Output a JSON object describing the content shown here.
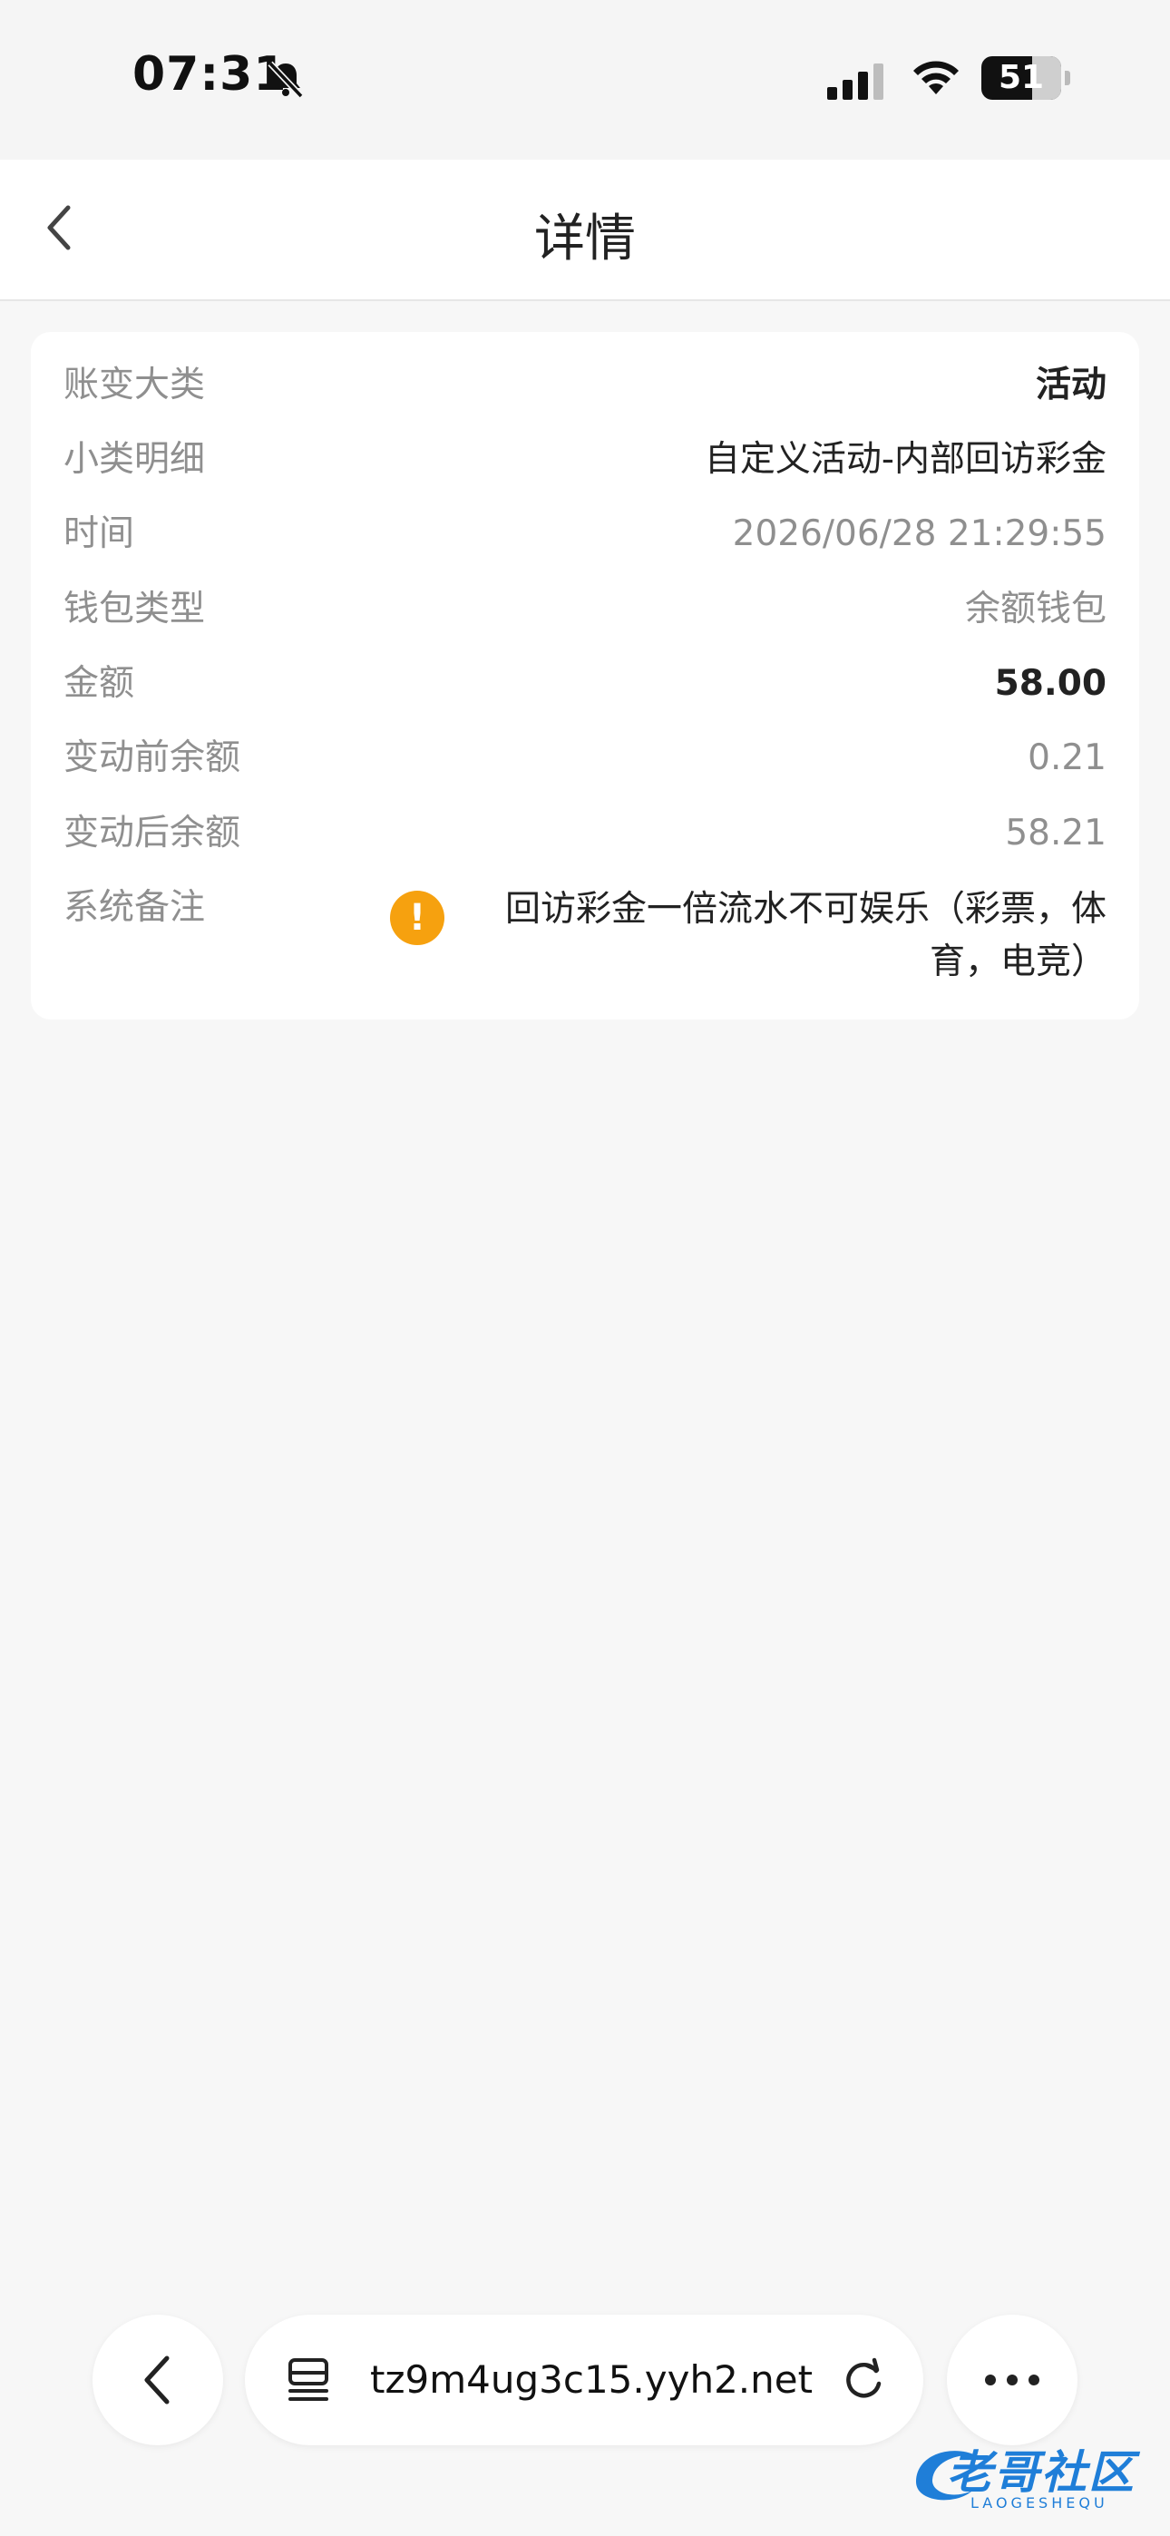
{
  "status_bar": {
    "time": "07:31",
    "battery": "51"
  },
  "header": {
    "title": "详情"
  },
  "details": {
    "rows": [
      {
        "label": "账变大类",
        "value": "活动"
      },
      {
        "label": "小类明细",
        "value": "自定义活动-内部回访彩金"
      },
      {
        "label": "时间",
        "value": "2026/06/28 21:29:55"
      },
      {
        "label": "钱包类型",
        "value": "余额钱包"
      },
      {
        "label": "金额",
        "value": "58.00"
      },
      {
        "label": "变动前余额",
        "value": "0.21"
      },
      {
        "label": "变动后余额",
        "value": "58.21"
      }
    ],
    "remark_label": "系统备注",
    "remark": "回访彩金一倍流水不可娱乐（彩票，体育，电竞）"
  },
  "browser": {
    "url": "tz9m4ug3c15.yyh2.net"
  },
  "watermark": {
    "text": "老哥社区",
    "sub": "LAOGESHEQU"
  },
  "colors": {
    "accent_warning": "#f6a10f",
    "watermark_blue": "#1f7ed8"
  }
}
